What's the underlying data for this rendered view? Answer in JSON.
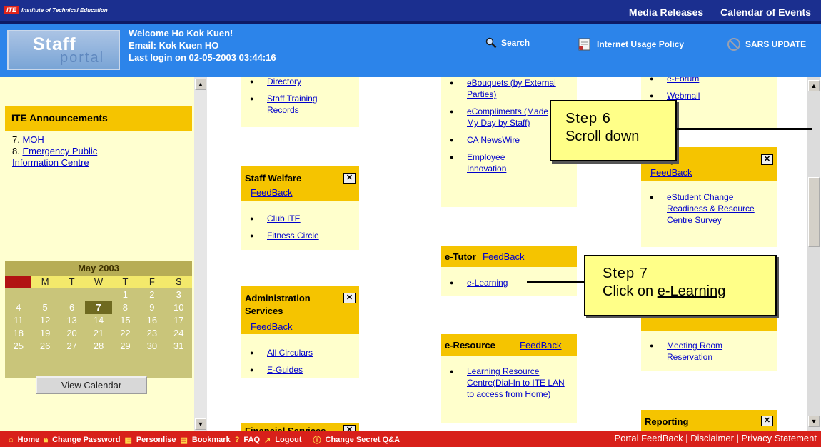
{
  "topbar": {
    "brand_mark": "ITE",
    "brand_name": "Institute of Technical Education",
    "links": [
      "Media Releases",
      "Calendar of Events"
    ]
  },
  "header": {
    "logo_line1": "Staff",
    "logo_line2": "portal",
    "welcome": "Welcome Ho Kok Kuen!",
    "email": "Email: Kok Kuen HO",
    "last_login": "Last login on 02-05-2003 03:44:16",
    "search": "Search",
    "policy": "Internet Usage Policy",
    "sars": "SARS UPDATE"
  },
  "announcements": {
    "title": "ITE Announcements",
    "items": [
      {
        "num": "7.",
        "text": "MOH"
      },
      {
        "num": "8.",
        "text": "Emergency Public Information Centre"
      }
    ]
  },
  "calendar": {
    "title": "May 2003",
    "days": [
      "S",
      "M",
      "T",
      "W",
      "T",
      "F",
      "S"
    ],
    "today": "7",
    "button": "View Calendar"
  },
  "col1": {
    "directory": "Directory",
    "training": "Staff Training Records",
    "welfare_title": "Staff Welfare",
    "welfare_fb": "FeedBack",
    "welfare_items": [
      "Club ITE",
      "Fitness Circle"
    ],
    "admin_title": "Administration Services",
    "admin_fb": "FeedBack",
    "admin_items": [
      "All Circulars",
      "E-Guides"
    ],
    "financial_title": "Financial Services"
  },
  "col2": {
    "top_items": [
      "eBouquets (by External Parties)",
      "eCompliments (Made My Day by Staff)",
      "CA NewsWire",
      "Employee Innovation"
    ],
    "etutor_title": "e-Tutor",
    "etutor_fb": "FeedBack",
    "etutor_items": [
      "e-Learning"
    ],
    "eresource_title": "e-Resource",
    "eresource_fb": "FeedBack",
    "eresource_items": [
      "Learning Resource Centre(Dial-In to ITE LAN to access from Home)"
    ]
  },
  "col3": {
    "top_items": [
      "e-Forum",
      "Webmail"
    ],
    "survey_title": "Survey",
    "survey_fb": "FeedBack",
    "survey_items": [
      "eStudent Change Readiness & Resource Centre Survey"
    ],
    "booking_items": [
      "Meeting Room Reservation"
    ],
    "reporting_title": "Reporting"
  },
  "callouts": {
    "step6_title": "Step 6",
    "step6_text": "Scroll down",
    "step7_title": "Step 7",
    "step7_text": "Click on",
    "step7_link": "e-Learning"
  },
  "footer": {
    "links": [
      "Home",
      "Change Password",
      "Personlise",
      "Bookmark",
      "FAQ",
      "Logout",
      "Change Secret Q&A"
    ],
    "right": "Portal FeedBack  |  Disclaimer  |  Privacy Statement"
  }
}
